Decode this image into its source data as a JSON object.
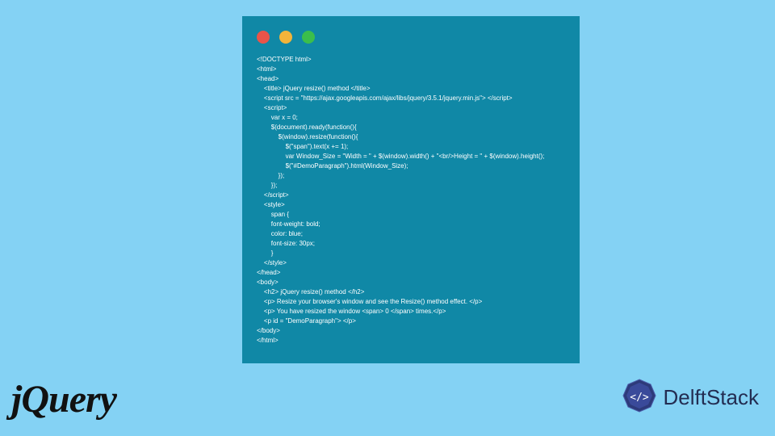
{
  "code": {
    "lines": [
      "<!DOCTYPE html>",
      "<html>",
      "<head>",
      "    <title> jQuery resize() method </title>",
      "    <script src = \"https://ajax.googleapis.com/ajax/libs/jquery/3.5.1/jquery.min.js\"> </script>",
      "    <script>",
      "        var x = 0;",
      "        $(document).ready(function(){",
      "            $(window).resize(function(){",
      "                $(\"span\").text(x += 1);",
      "                var Window_Size = \"Width = \" + $(window).width() + \"<br/>Height = \" + $(window).height();",
      "                $(\"#DemoParagraph\").html(Window_Size);",
      "            });",
      "        });",
      "    </script>",
      "    <style>",
      "        span {",
      "        font-weight: bold;",
      "        color: blue;",
      "        font-size: 30px;",
      "        }",
      "    </style>",
      "</head>",
      "<body>",
      "    <h2> jQuery resize() method </h2>",
      "    <p> Resize your browser's window and see the Resize() method effect. </p>",
      "    <p> You have resized the window <span> 0 </span> times.</p>",
      "    <p id = \"DemoParagraph\"> </p>",
      "</body>",
      "</html>"
    ]
  },
  "logos": {
    "jquery": "jQuery",
    "delftstack": "DelftStack"
  }
}
